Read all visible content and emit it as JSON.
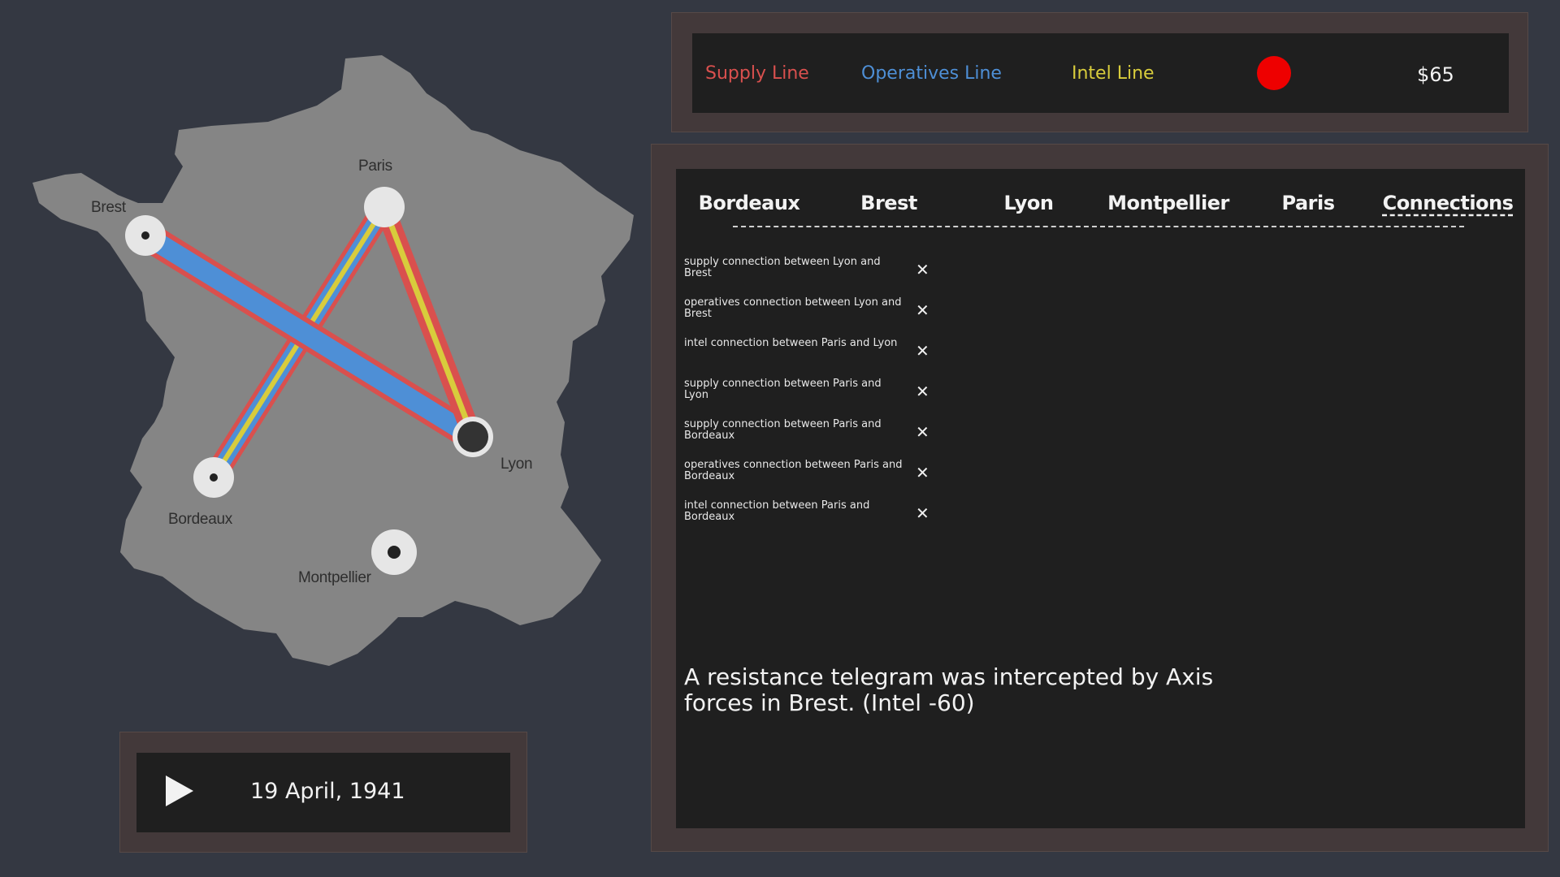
{
  "legend": {
    "supply_label": "Supply Line",
    "operatives_label": "Operatives Line",
    "intel_label": "Intel Line",
    "money": "$65",
    "supply_color": "#d9504e",
    "operatives_color": "#4e8fd6",
    "intel_color": "#d8cc3c",
    "status_color": "#ee0000"
  },
  "map": {
    "cities": [
      {
        "name": "Brest"
      },
      {
        "name": "Paris"
      },
      {
        "name": "Lyon"
      },
      {
        "name": "Bordeaux"
      },
      {
        "name": "Montpellier"
      }
    ]
  },
  "tabs": [
    {
      "label": "Bordeaux"
    },
    {
      "label": "Brest"
    },
    {
      "label": "Lyon"
    },
    {
      "label": "Montpellier"
    },
    {
      "label": "Paris"
    },
    {
      "label": "Connections"
    }
  ],
  "connections": [
    {
      "text": "supply connection between Lyon and Brest"
    },
    {
      "text": "operatives connection between Lyon and Brest"
    },
    {
      "text": "intel connection between Paris and Lyon"
    },
    {
      "text": "supply connection between Paris and Lyon"
    },
    {
      "text": "supply connection between Paris and Bordeaux"
    },
    {
      "text": "operatives connection between Paris and Bordeaux"
    },
    {
      "text": "intel connection between Paris and Bordeaux"
    }
  ],
  "remove_icon": "close-icon",
  "message": "A resistance telegram was intercepted by Axis forces in Brest. (Intel -60)",
  "timeline": {
    "date": "19 April, 1941",
    "play_icon": "play-icon"
  }
}
